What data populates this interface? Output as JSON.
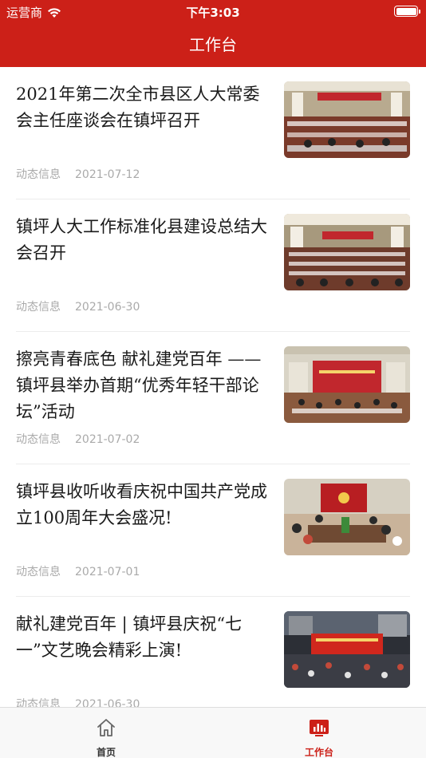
{
  "status_bar": {
    "carrier": "运营商",
    "time": "下午3:03"
  },
  "header": {
    "title": "工作台"
  },
  "news": [
    {
      "title": "2021年第二次全市县区人大常委会主任座谈会在镇坪召开",
      "category": "动态信息",
      "date": "2021-07-12"
    },
    {
      "title": "镇坪人大工作标准化县建设总结大会召开",
      "category": "动态信息",
      "date": "2021-06-30"
    },
    {
      "title": "擦亮青春底色 献礼建党百年 —— 镇坪县举办首期“优秀年轻干部论坛”活动",
      "category": "动态信息",
      "date": "2021-07-02"
    },
    {
      "title": "镇坪县收听收看庆祝中国共产党成立100周年大会盛况!",
      "category": "动态信息",
      "date": "2021-07-01"
    },
    {
      "title": "献礼建党百年 | 镇坪县庆祝“七一”文艺晚会精彩上演!",
      "category": "动态信息",
      "date": "2021-06-30"
    }
  ],
  "tabs": [
    {
      "label": "首页",
      "icon": "home-icon",
      "active": false
    },
    {
      "label": "工作台",
      "icon": "dashboard-chart-icon",
      "active": true
    }
  ],
  "colors": {
    "brand": "#cc2018",
    "meta_text": "#aaaaaa"
  }
}
